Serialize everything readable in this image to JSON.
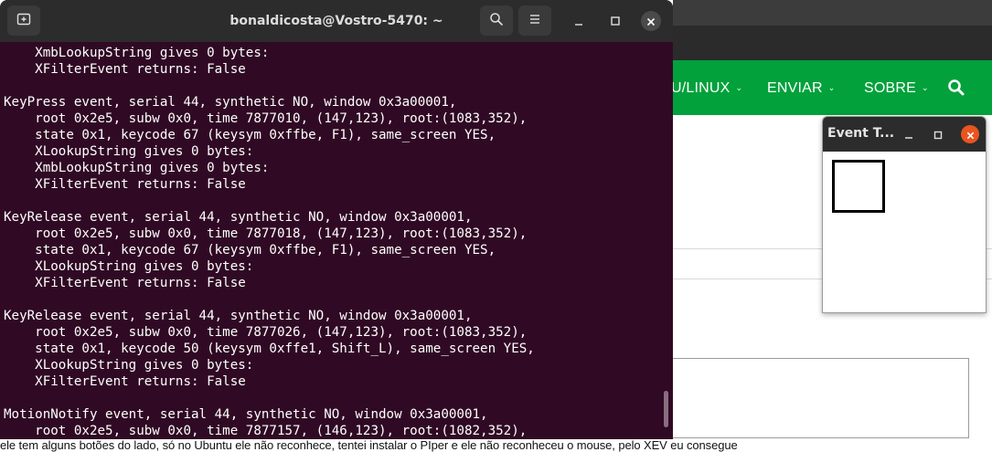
{
  "terminal": {
    "title": "bonaldicosta@Vostro-5470: ~",
    "lines": [
      "    XmbLookupString gives 0 bytes:",
      "    XFilterEvent returns: False",
      "",
      "KeyPress event, serial 44, synthetic NO, window 0x3a00001,",
      "    root 0x2e5, subw 0x0, time 7877010, (147,123), root:(1083,352),",
      "    state 0x1, keycode 67 (keysym 0xffbe, F1), same_screen YES,",
      "    XLookupString gives 0 bytes:",
      "    XmbLookupString gives 0 bytes:",
      "    XFilterEvent returns: False",
      "",
      "KeyRelease event, serial 44, synthetic NO, window 0x3a00001,",
      "    root 0x2e5, subw 0x0, time 7877018, (147,123), root:(1083,352),",
      "    state 0x1, keycode 67 (keysym 0xffbe, F1), same_screen YES,",
      "    XLookupString gives 0 bytes:",
      "    XFilterEvent returns: False",
      "",
      "KeyRelease event, serial 44, synthetic NO, window 0x3a00001,",
      "    root 0x2e5, subw 0x0, time 7877026, (147,123), root:(1083,352),",
      "    state 0x1, keycode 50 (keysym 0xffe1, Shift_L), same_screen YES,",
      "    XLookupString gives 0 bytes:",
      "    XFilterEvent returns: False",
      "",
      "MotionNotify event, serial 44, synthetic NO, window 0x3a00001,",
      "    root 0x2e5, subw 0x0, time 7877157, (146,123), root:(1082,352),"
    ],
    "icons": {
      "new_tab": "new-tab-icon",
      "search": "search-icon",
      "menu": "hamburger-menu-icon",
      "minimize": "minimize-icon",
      "maximize": "maximize-icon",
      "close": "close-icon"
    },
    "colors": {
      "background": "#300a24",
      "header": "#2c2c2c",
      "text": "#ffffff"
    }
  },
  "browser": {
    "nav": [
      {
        "label": "U/LINUX"
      },
      {
        "label": "ENVIAR"
      },
      {
        "label": "SOBRE"
      }
    ],
    "nav_color": "#02a13c",
    "bottom_text": "ele tem alguns botões do lado, só no Ubuntu ele não reconhece, tentei instalar o PIper e ele não reconheceu o mouse, pelo XEV eu consegue"
  },
  "event_tester": {
    "title": "Event T...",
    "close_color": "#e95420"
  }
}
